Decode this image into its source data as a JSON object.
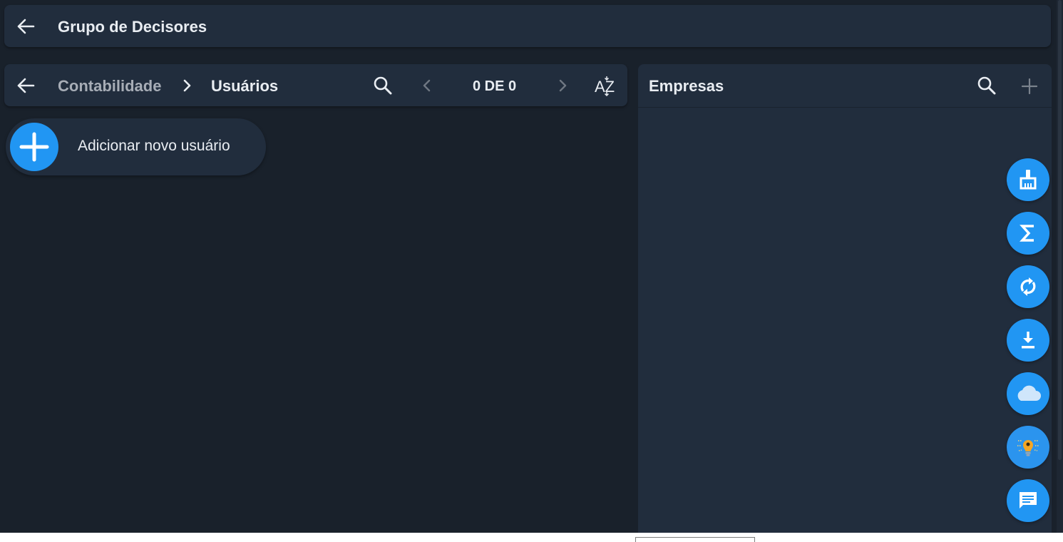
{
  "header": {
    "title": "Grupo de Decisores",
    "back_icon": "arrow-left-icon"
  },
  "users_panel": {
    "breadcrumb": {
      "parent": "Contabilidade",
      "current": "Usuários"
    },
    "pager_text": "0 DE 0",
    "sort_label_top": "AZ",
    "add_user_label": "Adicionar novo usuário"
  },
  "companies_panel": {
    "title": "Empresas"
  },
  "fabs": [
    {
      "name": "broom-icon"
    },
    {
      "name": "sigma-icon"
    },
    {
      "name": "sync-icon"
    },
    {
      "name": "download-icon"
    },
    {
      "name": "cloud-icon"
    },
    {
      "name": "lightbulb-icon"
    },
    {
      "name": "chat-icon"
    }
  ],
  "colors": {
    "background": "#19212b",
    "panel": "#212d3d",
    "accent": "#2196f3",
    "text": "#e9edf2",
    "muted_text": "#a7adb6"
  }
}
